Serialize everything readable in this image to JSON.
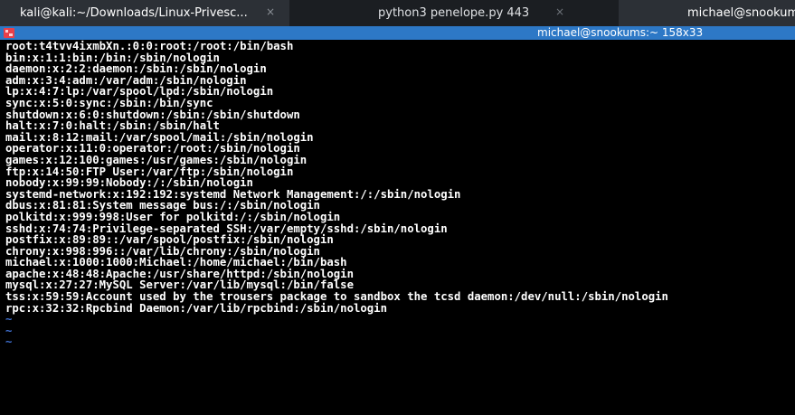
{
  "tabs": [
    {
      "label": "kali@kali:~/Downloads/Linux-Privesc...",
      "close_icon": "×"
    },
    {
      "label": "python3 penelope.py 443",
      "close_icon": "×"
    },
    {
      "label": "michael@snookums:~"
    }
  ],
  "window": {
    "title": "michael@snookums:~ 158x33"
  },
  "terminal": {
    "lines": [
      "root:t4tvv4ixmbXn.:0:0:root:/root:/bin/bash",
      "bin:x:1:1:bin:/bin:/sbin/nologin",
      "daemon:x:2:2:daemon:/sbin:/sbin/nologin",
      "adm:x:3:4:adm:/var/adm:/sbin/nologin",
      "lp:x:4:7:lp:/var/spool/lpd:/sbin/nologin",
      "sync:x:5:0:sync:/sbin:/bin/sync",
      "shutdown:x:6:0:shutdown:/sbin:/sbin/shutdown",
      "halt:x:7:0:halt:/sbin:/sbin/halt",
      "mail:x:8:12:mail:/var/spool/mail:/sbin/nologin",
      "operator:x:11:0:operator:/root:/sbin/nologin",
      "games:x:12:100:games:/usr/games:/sbin/nologin",
      "ftp:x:14:50:FTP User:/var/ftp:/sbin/nologin",
      "nobody:x:99:99:Nobody:/:/sbin/nologin",
      "systemd-network:x:192:192:systemd Network Management:/:/sbin/nologin",
      "dbus:x:81:81:System message bus:/:/sbin/nologin",
      "polkitd:x:999:998:User for polkitd:/:/sbin/nologin",
      "sshd:x:74:74:Privilege-separated SSH:/var/empty/sshd:/sbin/nologin",
      "postfix:x:89:89::/var/spool/postfix:/sbin/nologin",
      "chrony:x:998:996::/var/lib/chrony:/sbin/nologin",
      "michael:x:1000:1000:Michael:/home/michael:/bin/bash",
      "apache:x:48:48:Apache:/usr/share/httpd:/sbin/nologin",
      "mysql:x:27:27:MySQL Server:/var/lib/mysql:/bin/false",
      "tss:x:59:59:Account used by the trousers package to sandbox the tcsd daemon:/dev/null:/sbin/nologin",
      "rpc:x:32:32:Rpcbind Daemon:/var/lib/rpcbind:/sbin/nologin"
    ],
    "empty_line_markers": [
      "~",
      "~",
      "~"
    ]
  },
  "colors": {
    "tab_bar": "#1f2329",
    "title_bar": "#2d78c6",
    "terminal_bg": "#000000",
    "terminal_fg": "#ffffff",
    "tilde": "#3f6fcf"
  },
  "icons": {
    "window_icon": "terminal-app-icon",
    "tab_close": "close-icon"
  }
}
